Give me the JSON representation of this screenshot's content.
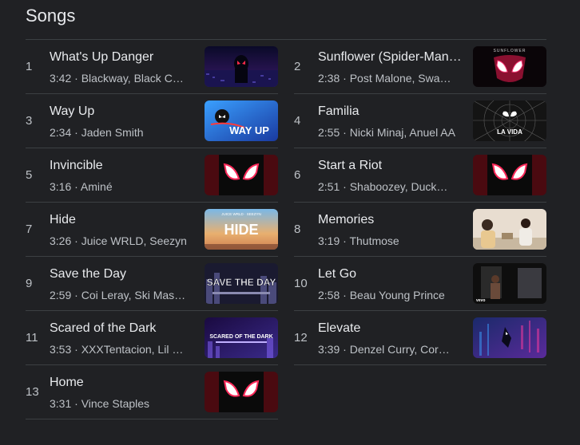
{
  "section": {
    "title": "Songs"
  },
  "songs": [
    {
      "num": "1",
      "title": "What's Up Danger",
      "duration": "3:42",
      "artists": "Blackway, Black Caviar",
      "thumb": "city-night-thumbnail"
    },
    {
      "num": "2",
      "title": "Sunflower (Spider-Man: Into the Spider-Verse)",
      "duration": "2:38",
      "artists": "Post Malone, Swae Lee",
      "thumb": "sunflower-mask-thumbnail",
      "thumb_text": "SUNFLOWER"
    },
    {
      "num": "3",
      "title": "Way Up",
      "duration": "2:34",
      "artists": "Jaden Smith",
      "thumb": "way-up-thumbnail",
      "thumb_text": "WAY UP"
    },
    {
      "num": "4",
      "title": "Familia",
      "duration": "2:55",
      "artists": "Nicki Minaj, Anuel AA",
      "thumb": "familia-thumbnail",
      "thumb_text": "LA VIDA"
    },
    {
      "num": "5",
      "title": "Invincible",
      "duration": "3:16",
      "artists": "Aminé",
      "thumb": "spider-mask-thumbnail"
    },
    {
      "num": "6",
      "title": "Start a Riot",
      "duration": "2:51",
      "artists": "Shaboozey, Duckwrth",
      "thumb": "spider-mask-thumbnail"
    },
    {
      "num": "7",
      "title": "Hide",
      "duration": "3:26",
      "artists": "Juice WRLD, Seezyn",
      "thumb": "hide-thumbnail",
      "thumb_text": "HIDE",
      "thumb_subtext": "JUICE WRLD · SEEZYN"
    },
    {
      "num": "8",
      "title": "Memories",
      "duration": "3:19",
      "artists": "Thutmose",
      "thumb": "memories-photo-thumbnail"
    },
    {
      "num": "9",
      "title": "Save the Day",
      "duration": "2:59",
      "artists": "Coi Leray, Ski Mask the Slump God",
      "thumb": "save-the-day-thumbnail",
      "thumb_text": "SAVE THE DAY"
    },
    {
      "num": "10",
      "title": "Let Go",
      "duration": "2:58",
      "artists": "Beau Young Prince",
      "thumb": "let-go-thumbnail",
      "thumb_text": "vevo"
    },
    {
      "num": "11",
      "title": "Scared of the Dark",
      "duration": "3:53",
      "artists": "XXXTentacion, Lil Wayne, Ty Dolla $ign",
      "thumb": "scared-of-the-dark-thumbnail",
      "thumb_text": "SCARED OF THE DARK"
    },
    {
      "num": "12",
      "title": "Elevate",
      "duration": "3:39",
      "artists": "Denzel Curry, Cordae",
      "thumb": "elevate-thumbnail"
    },
    {
      "num": "13",
      "title": "Home",
      "duration": "3:31",
      "artists": "Vince Staples",
      "thumb": "spider-mask-thumbnail"
    }
  ],
  "separator": " · "
}
